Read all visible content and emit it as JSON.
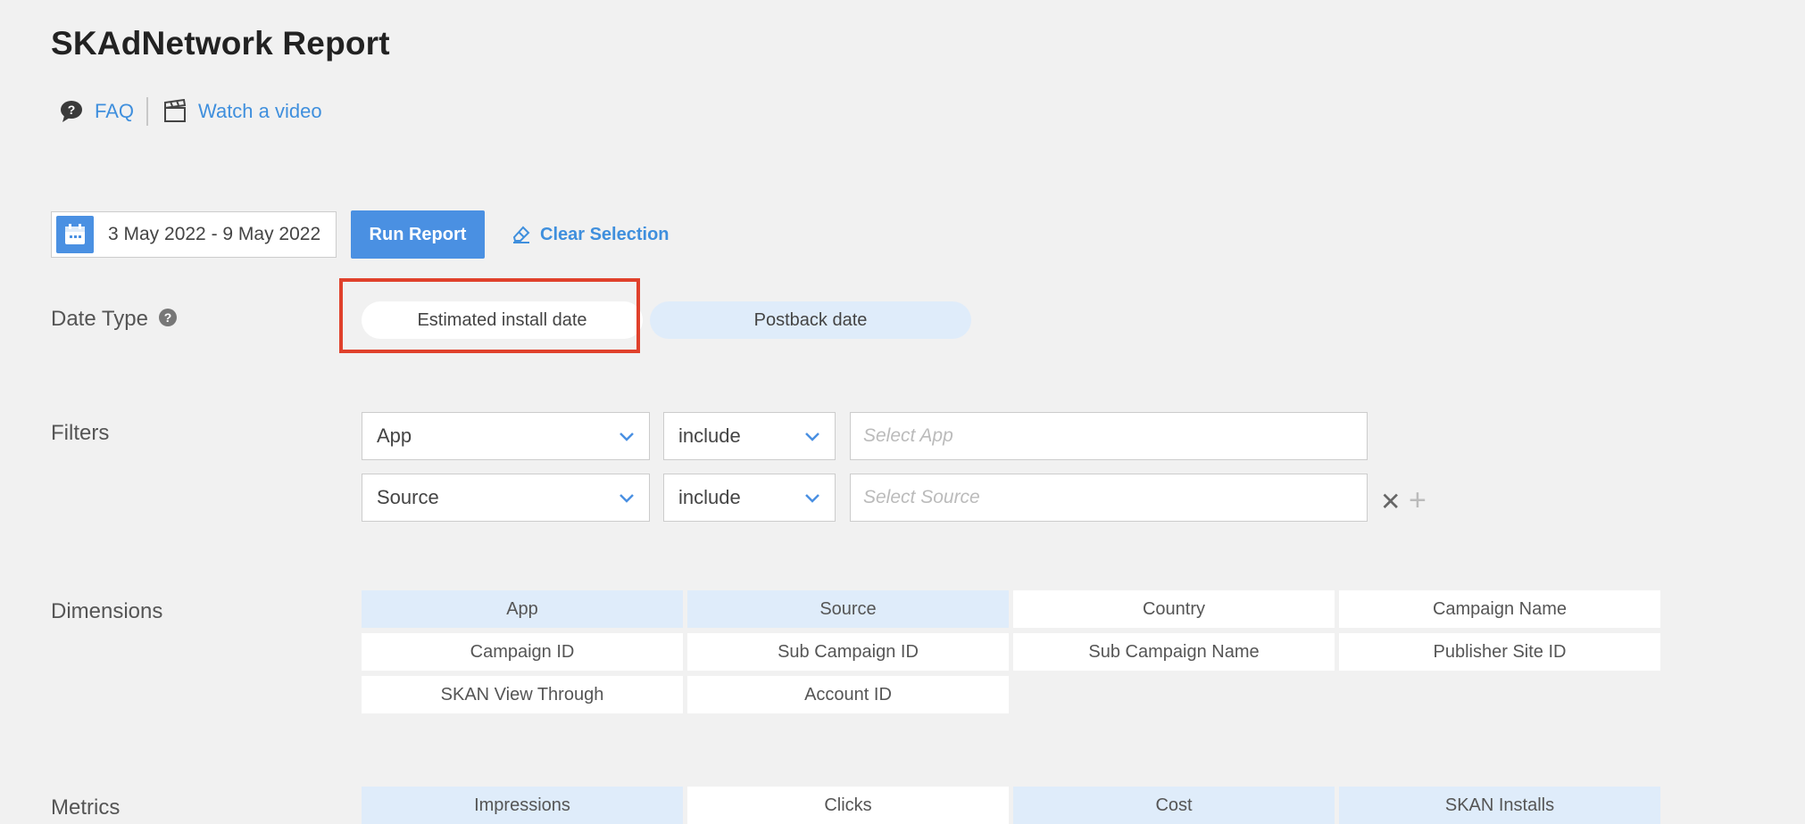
{
  "page": {
    "title": "SKAdNetwork Report"
  },
  "links": {
    "faq": "FAQ",
    "video": "Watch a video"
  },
  "toolbar": {
    "date_range": "3 May 2022 - 9 May 2022",
    "run_label": "Run Report",
    "clear_label": "Clear Selection"
  },
  "date_type": {
    "label": "Date Type",
    "options": [
      {
        "label": "Estimated install date",
        "selected": true
      },
      {
        "label": "Postback date",
        "selected": false
      }
    ]
  },
  "filters": {
    "label": "Filters",
    "rows": [
      {
        "field": "App",
        "operator": "include",
        "placeholder": "Select App"
      },
      {
        "field": "Source",
        "operator": "include",
        "placeholder": "Select Source"
      }
    ]
  },
  "dimensions": {
    "label": "Dimensions",
    "items": [
      {
        "label": "App",
        "selected": true
      },
      {
        "label": "Source",
        "selected": true
      },
      {
        "label": "Country",
        "selected": false
      },
      {
        "label": "Campaign Name",
        "selected": false
      },
      {
        "label": "Campaign ID",
        "selected": false
      },
      {
        "label": "Sub Campaign ID",
        "selected": false
      },
      {
        "label": "Sub Campaign Name",
        "selected": false
      },
      {
        "label": "Publisher Site ID",
        "selected": false
      },
      {
        "label": "SKAN View Through",
        "selected": false
      },
      {
        "label": "Account ID",
        "selected": false
      }
    ]
  },
  "metrics": {
    "label": "Metrics",
    "items": [
      {
        "label": "Impressions",
        "selected": true
      },
      {
        "label": "Clicks",
        "selected": false
      },
      {
        "label": "Cost",
        "selected": true
      },
      {
        "label": "SKAN Installs",
        "selected": true
      }
    ]
  },
  "colors": {
    "accent": "#4a90e2",
    "selected_bg": "#dfecfa",
    "highlight": "#e0412c"
  }
}
